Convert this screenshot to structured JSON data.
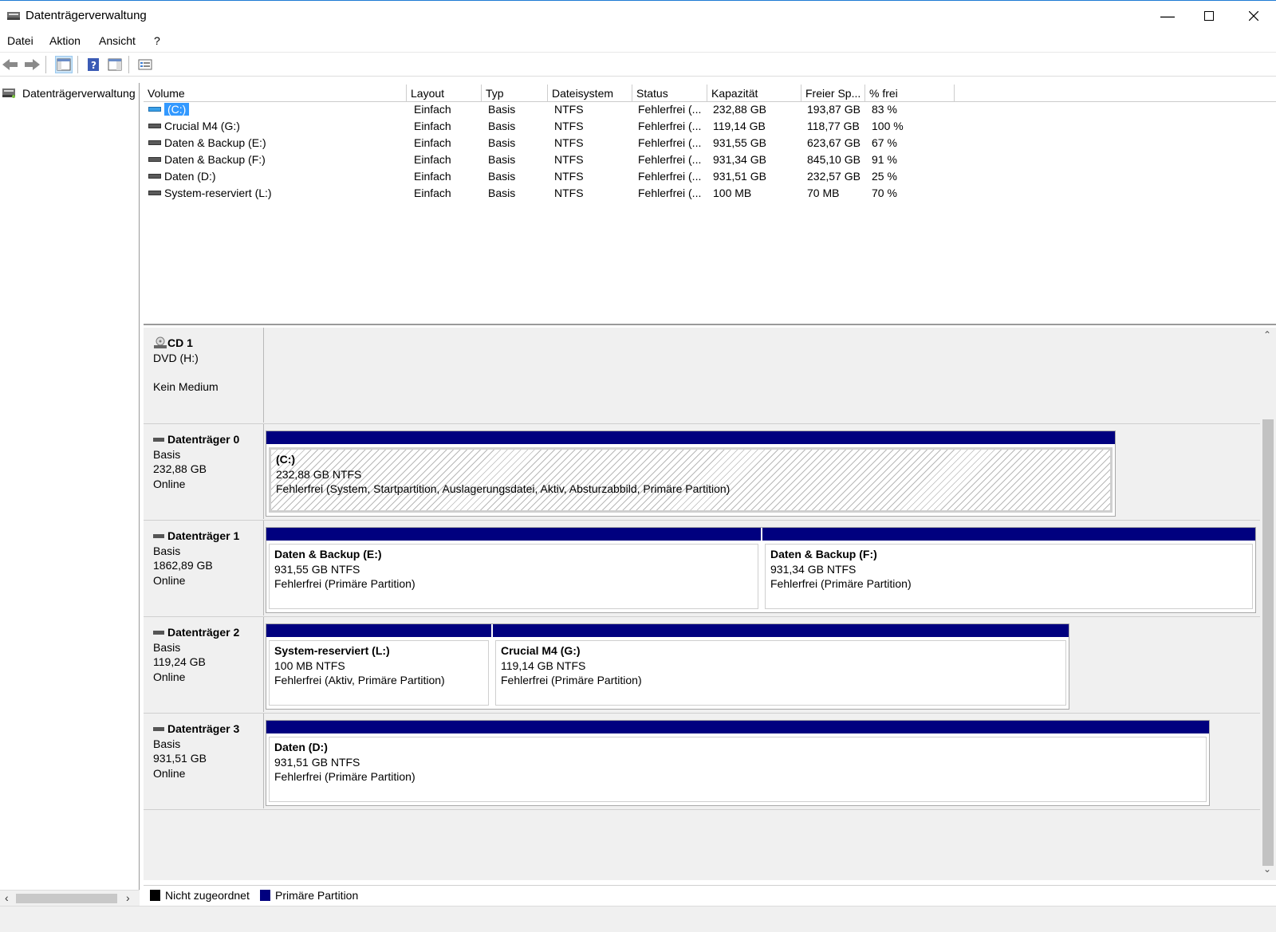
{
  "window": {
    "title": "Datenträgerverwaltung"
  },
  "menu": [
    "Datei",
    "Aktion",
    "Ansicht",
    "?"
  ],
  "tree": {
    "root_label": "Datenträgerverwaltung"
  },
  "columns": [
    "Volume",
    "Layout",
    "Typ",
    "Dateisystem",
    "Status",
    "Kapazität",
    "Freier Sp...",
    "% frei"
  ],
  "volumes": [
    {
      "volume": "(C:)",
      "layout": "Einfach",
      "typ": "Basis",
      "fs": "NTFS",
      "status": "Fehlerfrei (...",
      "cap": "232,88 GB",
      "free": "193,87 GB",
      "pct": "83 %"
    },
    {
      "volume": "Crucial M4 (G:)",
      "layout": "Einfach",
      "typ": "Basis",
      "fs": "NTFS",
      "status": "Fehlerfrei (...",
      "cap": "119,14 GB",
      "free": "118,77 GB",
      "pct": "100 %"
    },
    {
      "volume": "Daten & Backup (E:)",
      "layout": "Einfach",
      "typ": "Basis",
      "fs": "NTFS",
      "status": "Fehlerfrei (...",
      "cap": "931,55 GB",
      "free": "623,67 GB",
      "pct": "67 %"
    },
    {
      "volume": "Daten & Backup (F:)",
      "layout": "Einfach",
      "typ": "Basis",
      "fs": "NTFS",
      "status": "Fehlerfrei (...",
      "cap": "931,34 GB",
      "free": "845,10 GB",
      "pct": "91 %"
    },
    {
      "volume": "Daten (D:)",
      "layout": "Einfach",
      "typ": "Basis",
      "fs": "NTFS",
      "status": "Fehlerfrei (...",
      "cap": "931,51 GB",
      "free": "232,57 GB",
      "pct": "25 %"
    },
    {
      "volume": "System-reserviert (L:)",
      "layout": "Einfach",
      "typ": "Basis",
      "fs": "NTFS",
      "status": "Fehlerfrei (...",
      "cap": "100 MB",
      "free": "70 MB",
      "pct": "70 %"
    }
  ],
  "cd": {
    "name": "CD 1",
    "drive": "DVD (H:)",
    "media": "Kein Medium"
  },
  "disks": [
    {
      "name": "Datenträger 0",
      "type": "Basis",
      "size": "232,88 GB",
      "state": "Online",
      "partitions": [
        {
          "name": "(C:)",
          "size": "232,88 GB NTFS",
          "status": "Fehlerfrei (System, Startpartition, Auslagerungsdatei, Aktiv, Absturzabbild, Primäre Partition)"
        }
      ]
    },
    {
      "name": "Datenträger 1",
      "type": "Basis",
      "size": "1862,89 GB",
      "state": "Online",
      "partitions": [
        {
          "name": "Daten & Backup  (E:)",
          "size": "931,55 GB NTFS",
          "status": "Fehlerfrei (Primäre Partition)"
        },
        {
          "name": "Daten & Backup  (F:)",
          "size": "931,34 GB NTFS",
          "status": "Fehlerfrei (Primäre Partition)"
        }
      ]
    },
    {
      "name": "Datenträger 2",
      "type": "Basis",
      "size": "119,24 GB",
      "state": "Online",
      "partitions": [
        {
          "name": "System-reserviert  (L:)",
          "size": "100 MB NTFS",
          "status": "Fehlerfrei (Aktiv, Primäre Partition)"
        },
        {
          "name": "Crucial M4  (G:)",
          "size": "119,14 GB NTFS",
          "status": "Fehlerfrei (Primäre Partition)"
        }
      ]
    },
    {
      "name": "Datenträger 3",
      "type": "Basis",
      "size": "931,51 GB",
      "state": "Online",
      "partitions": [
        {
          "name": "Daten  (D:)",
          "size": "931,51 GB NTFS",
          "status": "Fehlerfrei (Primäre Partition)"
        }
      ]
    }
  ],
  "legend": [
    {
      "label": "Nicht zugeordnet",
      "color": "#000000"
    },
    {
      "label": "Primäre Partition",
      "color": "#00007f"
    }
  ],
  "colors": {
    "partition_bar": "#00007f",
    "selection": "#3399ff"
  }
}
